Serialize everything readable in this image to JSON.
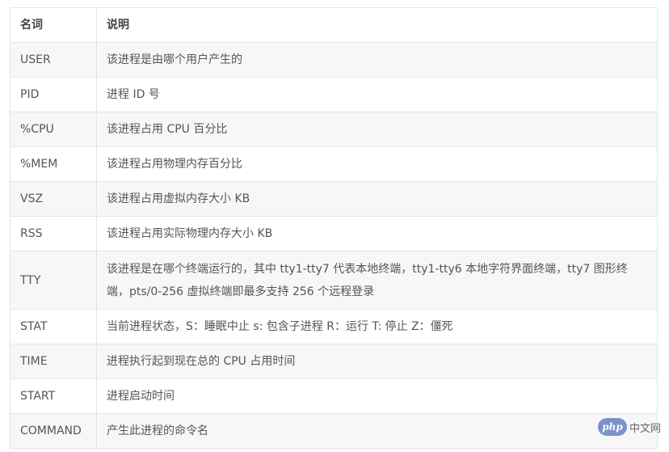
{
  "table": {
    "headers": [
      "名词",
      "说明"
    ],
    "rows": [
      {
        "term": "USER",
        "desc": "该进程是由哪个用户产生的"
      },
      {
        "term": "PID",
        "desc": "进程 ID 号"
      },
      {
        "term": "%CPU",
        "desc": "该进程占用 CPU 百分比"
      },
      {
        "term": "%MEM",
        "desc": "该进程占用物理内存百分比"
      },
      {
        "term": "VSZ",
        "desc": "该进程占用虚拟内存大小 KB"
      },
      {
        "term": "RSS",
        "desc": "该进程占用实际物理内存大小 KB"
      },
      {
        "term": "TTY",
        "desc": "该进程是在哪个终端运行的，其中 tty1-tty7 代表本地终端，tty1-tty6 本地字符界面终端，tty7 图形终端，pts/0-256 虚拟终端即最多支持 256 个远程登录"
      },
      {
        "term": "STAT",
        "desc": "当前进程状态，S：睡眠中止 s: 包含子进程 R：运行 T: 停止 Z：僵死"
      },
      {
        "term": "TIME",
        "desc": "进程执行起到现在总的 CPU 占用时间"
      },
      {
        "term": "START",
        "desc": "进程启动时间"
      },
      {
        "term": "COMMAND",
        "desc": "产生此进程的命令名"
      }
    ]
  },
  "watermark": {
    "logo_text": "php",
    "site_text": "中文网"
  }
}
